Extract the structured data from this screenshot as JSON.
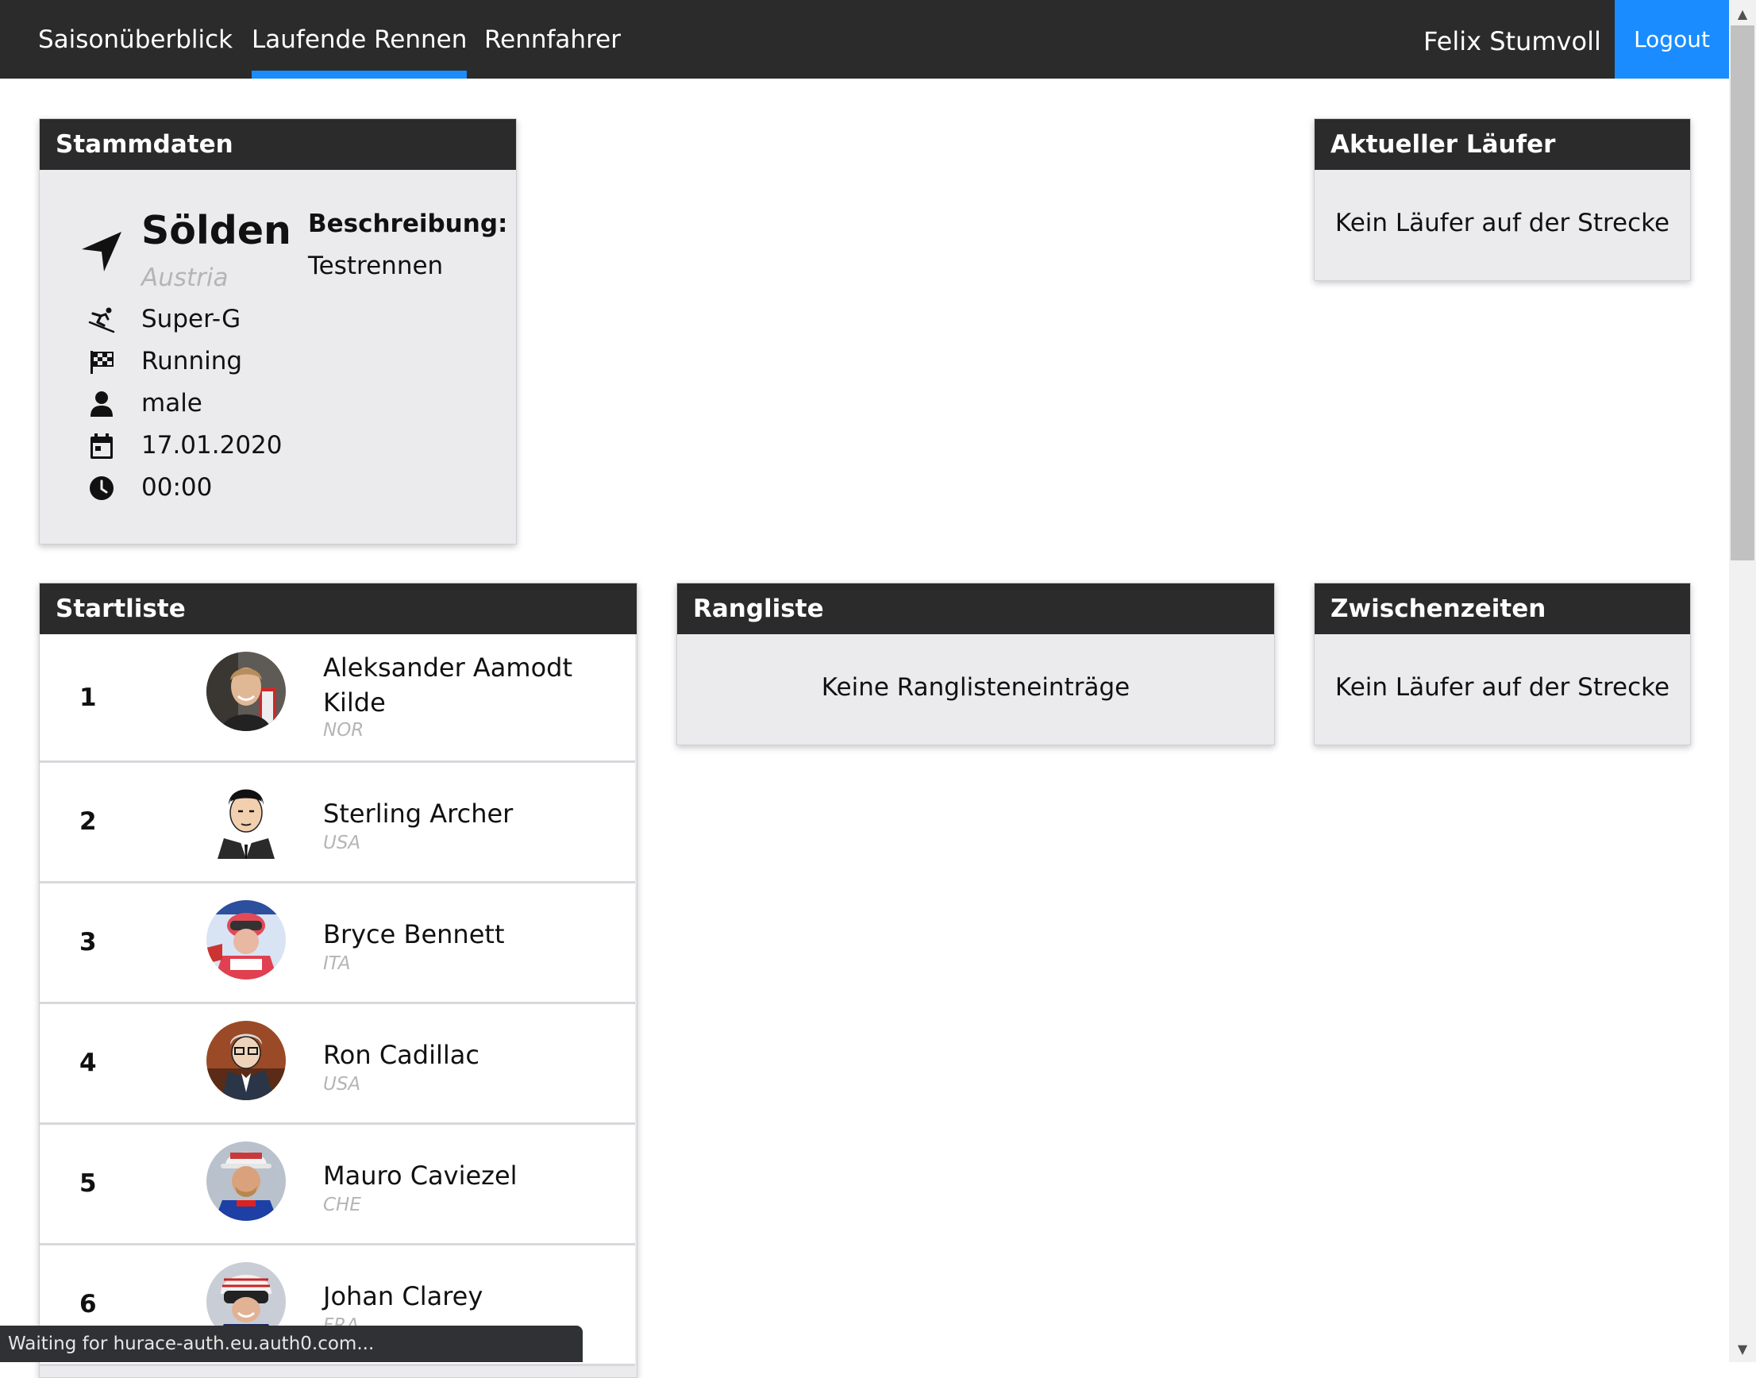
{
  "nav": {
    "items": [
      "Saisonüberblick",
      "Laufende Rennen",
      "Rennfahrer"
    ],
    "active_index": 1,
    "user_name": "Felix Stumvoll",
    "logout_label": "Logout"
  },
  "stammdaten": {
    "header": "Stammdaten",
    "location": "Sölden",
    "country": "Austria",
    "discipline": "Super-G",
    "status": "Running",
    "gender": "male",
    "date": "17.01.2020",
    "time": "00:00",
    "description_label": "Beschreibung:",
    "description": "Testrennen",
    "icons": [
      "location-arrow-icon",
      "skiing-icon",
      "checkered-flag-icon",
      "user-icon",
      "calendar-icon",
      "clock-icon"
    ]
  },
  "current_runner": {
    "header": "Aktueller Läufer",
    "empty_text": "Kein Läufer auf der Strecke"
  },
  "startlist": {
    "header": "Startliste",
    "entries": [
      {
        "number": "1",
        "name": "Aleksander Aamodt Kilde",
        "country": "NOR"
      },
      {
        "number": "2",
        "name": "Sterling Archer",
        "country": "USA"
      },
      {
        "number": "3",
        "name": "Bryce Bennett",
        "country": "ITA"
      },
      {
        "number": "4",
        "name": "Ron Cadillac",
        "country": "USA"
      },
      {
        "number": "5",
        "name": "Mauro Caviezel",
        "country": "CHE"
      },
      {
        "number": "6",
        "name": "Johan Clarey",
        "country": "FRA"
      }
    ]
  },
  "ranking": {
    "header": "Rangliste",
    "empty_text": "Keine Ranglisteneinträge"
  },
  "splits": {
    "header": "Zwischenzeiten",
    "empty_text": "Kein Läufer auf der Strecke"
  },
  "statusbar": {
    "text": "Waiting for hurace-auth.eu.auth0.com..."
  },
  "colors": {
    "navbar": "#2b2b2b",
    "accent": "#1a8cff",
    "card_bg": "#ebebee",
    "muted_text": "#b5b5b5"
  }
}
